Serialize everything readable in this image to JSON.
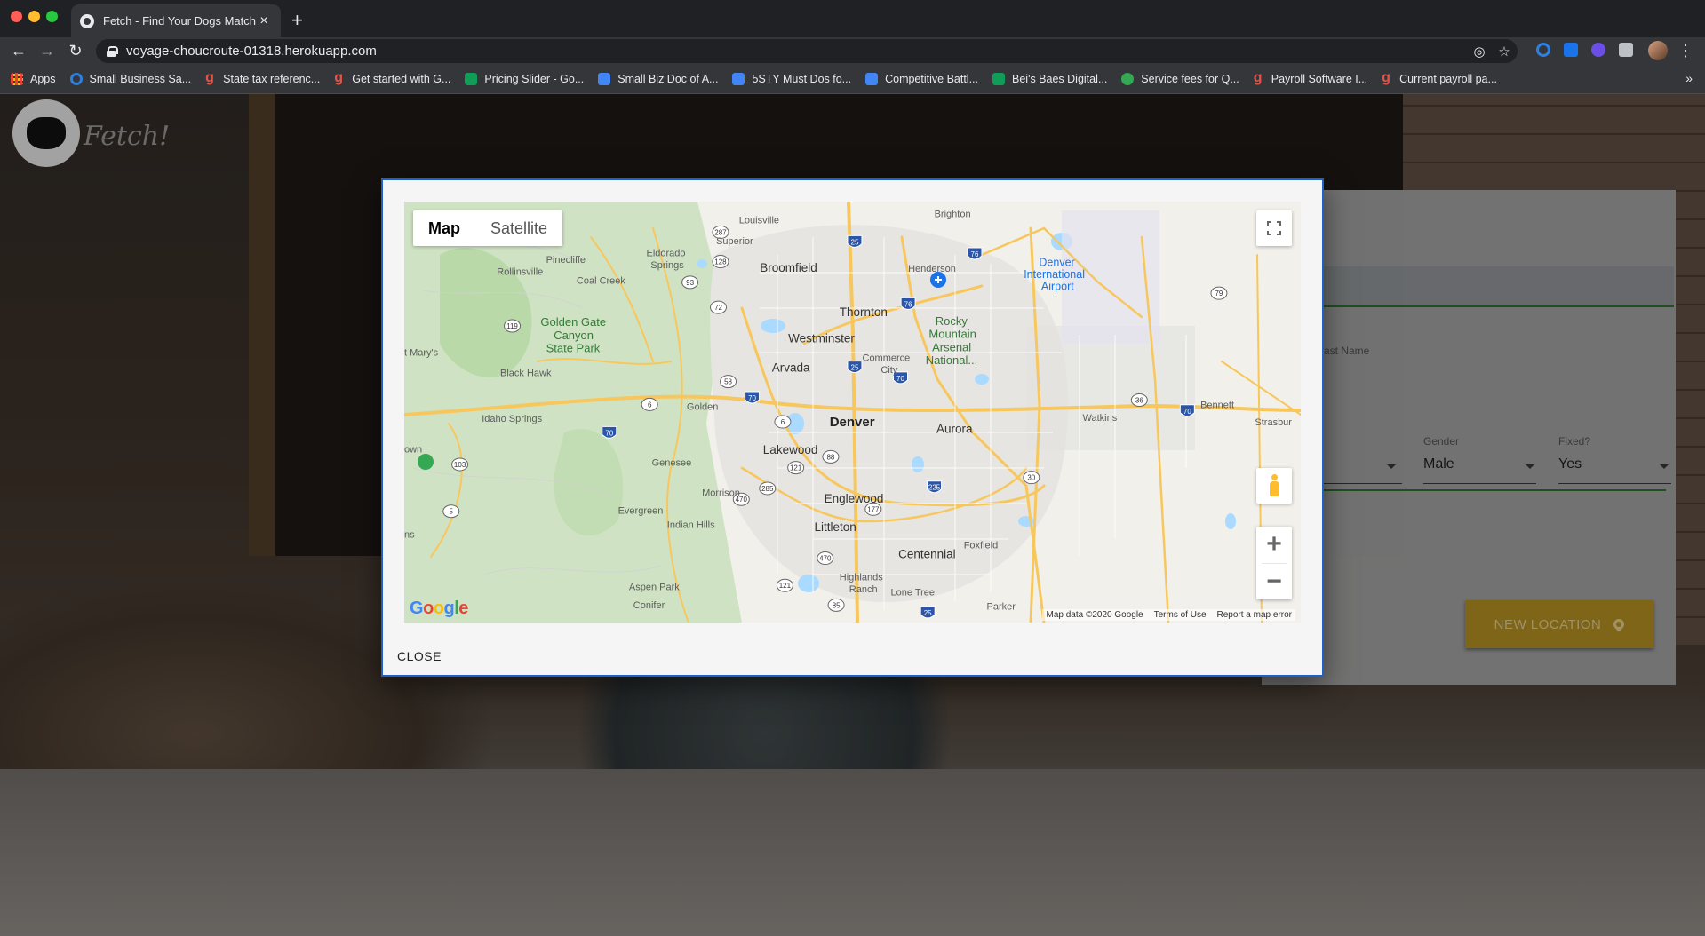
{
  "browser": {
    "tab_title": "Fetch - Find Your Dogs Match",
    "tab_close": "×",
    "new_tab": "+",
    "url": "voyage-choucroute-01318.herokuapp.com",
    "nav": {
      "back": "←",
      "forward": "→",
      "reload": "↻",
      "menu": "⋮"
    },
    "bookmarks": [
      {
        "label": "Apps",
        "icon": "apps-grid-icon"
      },
      {
        "label": "Small Business Sa...",
        "icon": "circle-icon"
      },
      {
        "label": "State tax referenc...",
        "icon": "g-icon"
      },
      {
        "label": "Get started with G...",
        "icon": "g-icon"
      },
      {
        "label": "Pricing Slider - Go...",
        "icon": "sheets-icon"
      },
      {
        "label": "Small Biz Doc of A...",
        "icon": "docs-icon"
      },
      {
        "label": "5STY Must Dos fo...",
        "icon": "docs-icon"
      },
      {
        "label": "Competitive Battl...",
        "icon": "docs-icon"
      },
      {
        "label": "Bei's Baes Digital...",
        "icon": "sheets-icon"
      },
      {
        "label": "Service fees for Q...",
        "icon": "green-circle-icon"
      },
      {
        "label": "Payroll Software I...",
        "icon": "g-icon"
      },
      {
        "label": "Current payroll pa...",
        "icon": "g-icon"
      }
    ],
    "bookmarks_more": "»"
  },
  "app": {
    "logo_text": "Fetch!",
    "form": {
      "last_name_label": "ast Name",
      "gender_label": "Gender",
      "gender_value": "Male",
      "fixed_label": "Fixed?",
      "fixed_value": "Yes",
      "new_location_button": "NEW LOCATION"
    }
  },
  "modal": {
    "map_type_options": [
      "Map",
      "Satellite"
    ],
    "active_map_type": "Map",
    "zoom_in": "+",
    "zoom_out": "−",
    "google_logo": "Google",
    "footer": {
      "map_data": "Map data ©2020 Google",
      "terms": "Terms of Use",
      "report": "Report a map error"
    },
    "close_button": "CLOSE",
    "places": {
      "louisville": "Louisville",
      "brighton": "Brighton",
      "superior": "Superior",
      "eldorado_springs_1": "Eldorado",
      "eldorado_springs_2": "Springs",
      "pinecliffe": "Pinecliffe",
      "rollinsville": "Rollinsville",
      "coal_creek": "Coal Creek",
      "broomfield": "Broomfield",
      "henderson": "Henderson",
      "dia_1": "Denver",
      "dia_2": "International",
      "dia_3": "Airport",
      "thornton": "Thornton",
      "golden_gate_1": "Golden Gate",
      "golden_gate_2": "Canyon",
      "golden_gate_3": "State Park",
      "st_marys": "t Mary's",
      "westminster": "Westminster",
      "rma_1": "Rocky",
      "rma_2": "Mountain",
      "rma_3": "Arsenal",
      "rma_4": "National...",
      "black_hawk": "Black Hawk",
      "arvada": "Arvada",
      "commerce_city_1": "Commerce",
      "commerce_city_2": "City",
      "bennett": "Bennett",
      "golden": "Golden",
      "idaho_springs": "Idaho Springs",
      "denver": "Denver",
      "aurora": "Aurora",
      "watkins": "Watkins",
      "strasburg": "Strasbur",
      "town": "own",
      "lakewood": "Lakewood",
      "genesee": "Genesee",
      "morrison": "Morrison",
      "englewood": "Englewood",
      "evergreen": "Evergreen",
      "indian_hills": "Indian Hills",
      "littleton": "Littleton",
      "ns": "ns",
      "foxfield": "Foxfield",
      "centennial": "Centennial",
      "highlands_ranch_1": "Highlands",
      "highlands_ranch_2": "Ranch",
      "lone_tree": "Lone Tree",
      "aspen_park": "Aspen Park",
      "conifer": "Conifer",
      "parker": "Parker"
    },
    "shields": [
      "287",
      "25",
      "76",
      "93",
      "128",
      "72",
      "76",
      "119",
      "79",
      "25",
      "70",
      "58",
      "70",
      "6",
      "70",
      "6",
      "36",
      "70",
      "88",
      "121",
      "103",
      "285",
      "225",
      "470",
      "30",
      "177",
      "5",
      "470",
      "121",
      "85",
      "25"
    ]
  }
}
